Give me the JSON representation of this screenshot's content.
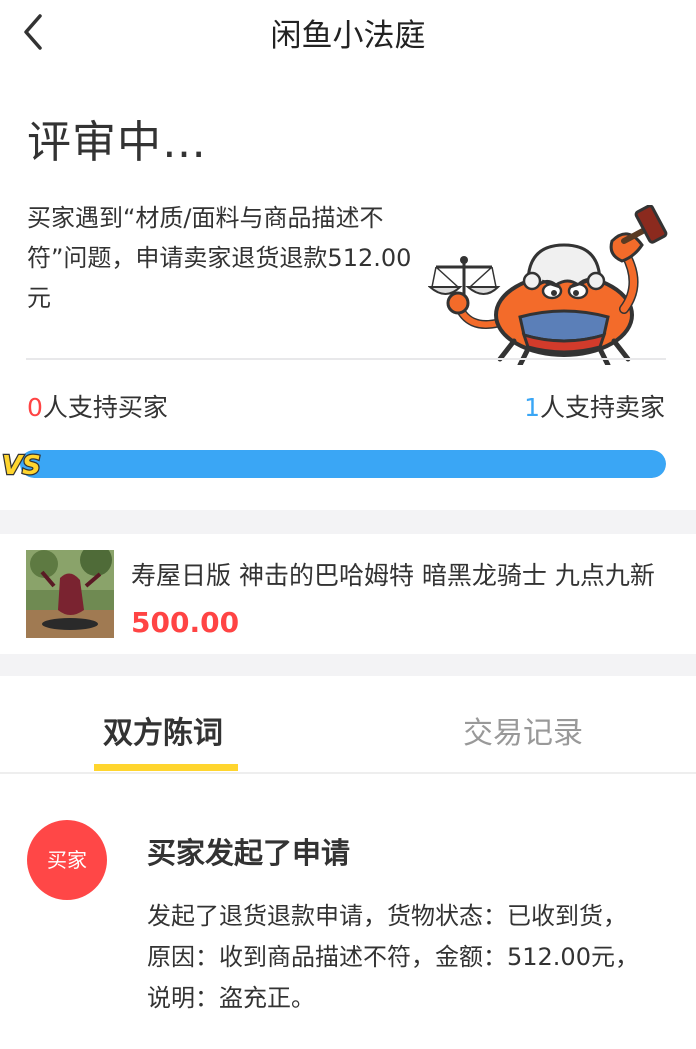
{
  "nav": {
    "title": "闲鱼小法庭"
  },
  "status": {
    "text": "评审中…"
  },
  "case": {
    "description": "买家遇到“材质/面料与商品描述不符”问题，申请卖家退货退款512.00元"
  },
  "support": {
    "buyer_count": "0",
    "buyer_label": "人支持买家",
    "seller_count": "1",
    "seller_label": "人支持卖家",
    "seller_share": 1.0,
    "vs_label": "VS"
  },
  "product": {
    "title": "寿屋日版 神击的巴哈姆特 暗黑龙骑士 九点九新",
    "price": "500.00"
  },
  "tabs": [
    {
      "label": "双方陈词",
      "active": true
    },
    {
      "label": "交易记录",
      "active": false
    }
  ],
  "statement": {
    "avatar_label": "买家",
    "title": "买家发起了申请",
    "body": "发起了退货退款申请，货物状态：已收到货，原因：收到商品描述不符，金额：512.00元，说明：盗充正。"
  },
  "colors": {
    "accent_red": "#ff4444",
    "accent_blue": "#3aa6f5",
    "tab_underline": "#ffd52e"
  }
}
